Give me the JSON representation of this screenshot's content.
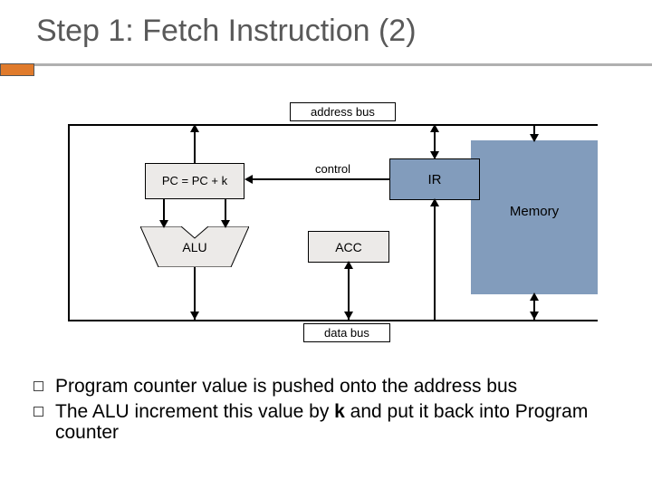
{
  "title": "Step 1: Fetch Instruction (2)",
  "diagram": {
    "address_bus": "address  bus",
    "data_bus": "data  bus",
    "control": "control",
    "pc": "PC = PC + k",
    "alu": "ALU",
    "acc": "ACC",
    "ir": "IR",
    "memory": "Memory"
  },
  "bullets": [
    {
      "pre": "Program counter value is pushed onto the address bus",
      "bold": "",
      "post": ""
    },
    {
      "pre": "The ALU increment this value by ",
      "bold": "k",
      "post": " and put it back into Program counter"
    }
  ]
}
